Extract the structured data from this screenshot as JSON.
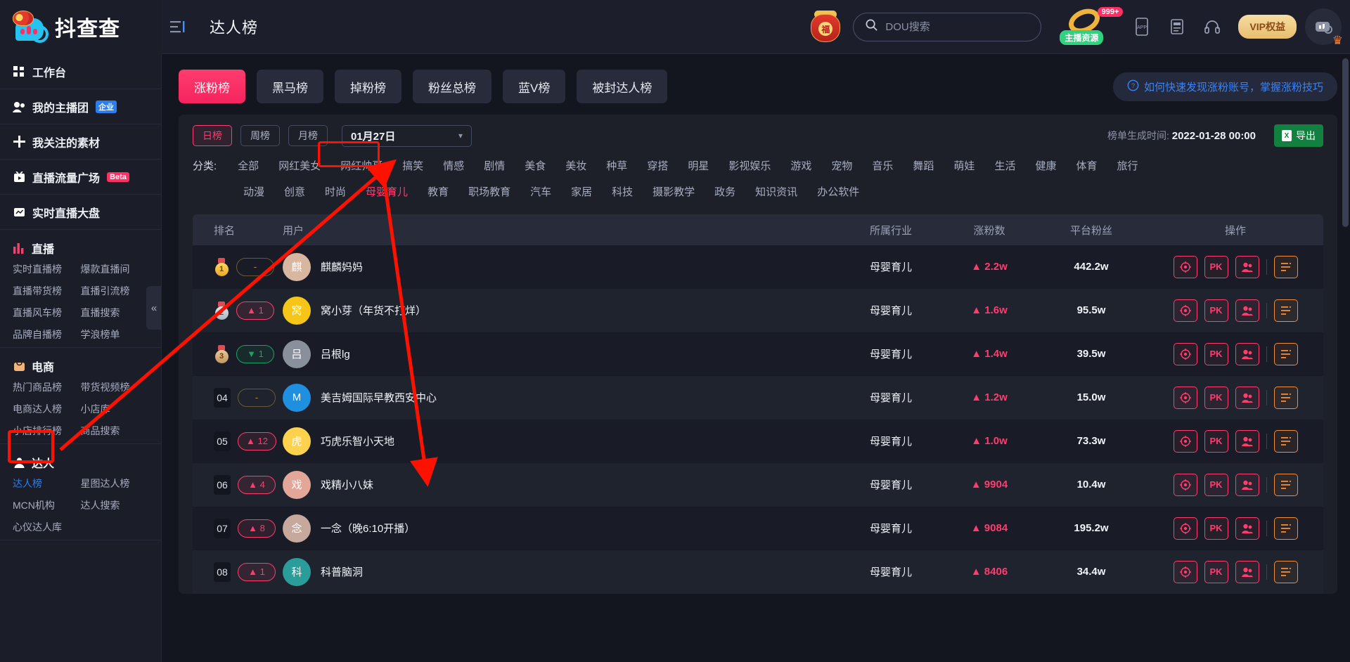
{
  "brand": {
    "name": "抖查查",
    "collapse_icon": "panel-toggle-icon"
  },
  "header": {
    "page_title": "达人榜",
    "search_placeholder": "DOU搜索",
    "search_value": "",
    "anchor_resource_label": "主播资源",
    "anchor_resource_badge": "999+",
    "vip_label": "VIP权益",
    "fu_char": "福",
    "icons": [
      "app-download-icon",
      "doc-icon",
      "headset-icon"
    ]
  },
  "sidebar": {
    "top_items": [
      {
        "label": "工作台",
        "icon": "grid-icon",
        "badge": ""
      },
      {
        "label": "我的主播团",
        "icon": "user-group-icon",
        "badge": "企业"
      },
      {
        "label": "我关注的素材",
        "icon": "plus-icon",
        "badge": ""
      },
      {
        "label": "直播流量广场",
        "icon": "live-tv-icon",
        "badge": "Beta"
      },
      {
        "label": "实时直播大盘",
        "icon": "chart-line-icon",
        "badge": ""
      }
    ],
    "groups": [
      {
        "title": "直播",
        "icon": "bar-chart-icon",
        "links": [
          {
            "label": "实时直播榜",
            "active": false
          },
          {
            "label": "爆款直播间",
            "active": false
          },
          {
            "label": "直播带货榜",
            "active": false
          },
          {
            "label": "直播引流榜",
            "active": false
          },
          {
            "label": "直播风车榜",
            "active": false
          },
          {
            "label": "直播搜索",
            "active": false
          },
          {
            "label": "品牌自播榜",
            "active": false
          },
          {
            "label": "学浪榜单",
            "active": false
          }
        ]
      },
      {
        "title": "电商",
        "icon": "bag-icon",
        "links": [
          {
            "label": "热门商品榜",
            "active": false
          },
          {
            "label": "带货视频榜",
            "active": false
          },
          {
            "label": "电商达人榜",
            "active": false
          },
          {
            "label": "小店库",
            "active": false
          },
          {
            "label": "小店排行榜",
            "active": false
          },
          {
            "label": "商品搜索",
            "active": false
          }
        ]
      },
      {
        "title": "达人",
        "icon": "person-icon",
        "links": [
          {
            "label": "达人榜",
            "active": true
          },
          {
            "label": "星图达人榜",
            "active": false
          },
          {
            "label": "MCN机构",
            "active": false
          },
          {
            "label": "达人搜索",
            "active": false
          },
          {
            "label": "心仪达人库",
            "active": false
          }
        ]
      }
    ],
    "collapse_handle": "«"
  },
  "tabs": [
    {
      "label": "涨粉榜",
      "active": true
    },
    {
      "label": "黑马榜",
      "active": false
    },
    {
      "label": "掉粉榜",
      "active": false
    },
    {
      "label": "粉丝总榜",
      "active": false
    },
    {
      "label": "蓝V榜",
      "active": false
    },
    {
      "label": "被封达人榜",
      "active": false
    }
  ],
  "tips": {
    "icon": "question-circle-icon",
    "text": "如何快速发现涨粉账号，掌握涨粉技巧"
  },
  "filters": {
    "periods": [
      {
        "label": "日榜",
        "active": true
      },
      {
        "label": "周榜",
        "active": false
      },
      {
        "label": "月榜",
        "active": false
      }
    ],
    "date_value": "01月27日",
    "date_chevron": "chevron-down-icon",
    "gen_time_label": "榜单生成时间:",
    "gen_time_value": "2022-01-28 00:00",
    "export_label": "导出",
    "export_icon": "excel-icon"
  },
  "categories": {
    "label": "分类:",
    "row1": [
      "全部",
      "网红美女",
      "网红帅哥",
      "搞笑",
      "情感",
      "剧情",
      "美食",
      "美妆",
      "种草",
      "穿搭",
      "明星",
      "影视娱乐",
      "游戏",
      "宠物",
      "音乐",
      "舞蹈",
      "萌娃",
      "生活",
      "健康",
      "体育",
      "旅行"
    ],
    "row2": [
      "动漫",
      "创意",
      "时尚",
      "母婴育儿",
      "教育",
      "职场教育",
      "汽车",
      "家居",
      "科技",
      "摄影教学",
      "政务",
      "知识资讯",
      "办公软件"
    ],
    "active": "母婴育儿"
  },
  "table": {
    "columns": [
      "排名",
      "用户",
      "所属行业",
      "涨粉数",
      "平台粉丝",
      "操作"
    ],
    "action_icons": [
      "target-icon",
      "pk-icon",
      "fans-icon",
      "report-icon"
    ],
    "rows": [
      {
        "rank": "1",
        "medal": "gold",
        "change": "-",
        "change_dir": "flat",
        "name": "麒麟妈妈",
        "industry": "母婴育儿",
        "gain": "2.2w",
        "gain_dir": "up",
        "fans": "442.2w",
        "avatar_color": "#d8b7a0",
        "avatar_text": "麒"
      },
      {
        "rank": "2",
        "medal": "silver",
        "change": "1",
        "change_dir": "up",
        "name": "窝小芽（年货不打烊）",
        "industry": "母婴育儿",
        "gain": "1.6w",
        "gain_dir": "up",
        "fans": "95.5w",
        "avatar_color": "#f5c518",
        "avatar_text": "窝"
      },
      {
        "rank": "3",
        "medal": "bronze",
        "change": "1",
        "change_dir": "down",
        "name": "吕根lg",
        "industry": "母婴育儿",
        "gain": "1.4w",
        "gain_dir": "up",
        "fans": "39.5w",
        "avatar_color": "#8a8f9c",
        "avatar_text": "吕"
      },
      {
        "rank": "04",
        "medal": "",
        "change": "-",
        "change_dir": "flat",
        "name": "美吉姆国际早教西安中心",
        "industry": "母婴育儿",
        "gain": "1.2w",
        "gain_dir": "up",
        "fans": "15.0w",
        "avatar_color": "#1f8fe0",
        "avatar_text": "M"
      },
      {
        "rank": "05",
        "medal": "",
        "change": "12",
        "change_dir": "up",
        "name": "巧虎乐智小天地",
        "industry": "母婴育儿",
        "gain": "1.0w",
        "gain_dir": "up",
        "fans": "73.3w",
        "avatar_color": "#ffd24d",
        "avatar_text": "虎"
      },
      {
        "rank": "06",
        "medal": "",
        "change": "4",
        "change_dir": "up",
        "name": "戏精小八妹",
        "industry": "母婴育儿",
        "gain": "9904",
        "gain_dir": "up",
        "fans": "10.4w",
        "avatar_color": "#e3a79a",
        "avatar_text": "戏"
      },
      {
        "rank": "07",
        "medal": "",
        "change": "8",
        "change_dir": "up",
        "name": "一念（晚6:10开播）",
        "industry": "母婴育儿",
        "gain": "9084",
        "gain_dir": "up",
        "fans": "195.2w",
        "avatar_color": "#c7a89c",
        "avatar_text": "念"
      },
      {
        "rank": "08",
        "medal": "",
        "change": "1",
        "change_dir": "up",
        "name": "科普脑洞",
        "industry": "母婴育儿",
        "gain": "8406",
        "gain_dir": "up",
        "fans": "34.4w",
        "avatar_color": "#2a9d9a",
        "avatar_text": "科"
      }
    ]
  },
  "annotations": {
    "highlight_boxes": [
      "sidebar-darren-group",
      "category-muying-yuer"
    ],
    "arrows": [
      "arrow-from-darren-to-category",
      "arrow-from-category-to-row5"
    ],
    "color": "#ff1100"
  },
  "colors": {
    "accent_pink": "#ff3c6e",
    "green": "#19a463",
    "blue": "#2b7ef0",
    "orange": "#f08c3a",
    "bg": "#14161f",
    "panel": "#1d2029"
  }
}
